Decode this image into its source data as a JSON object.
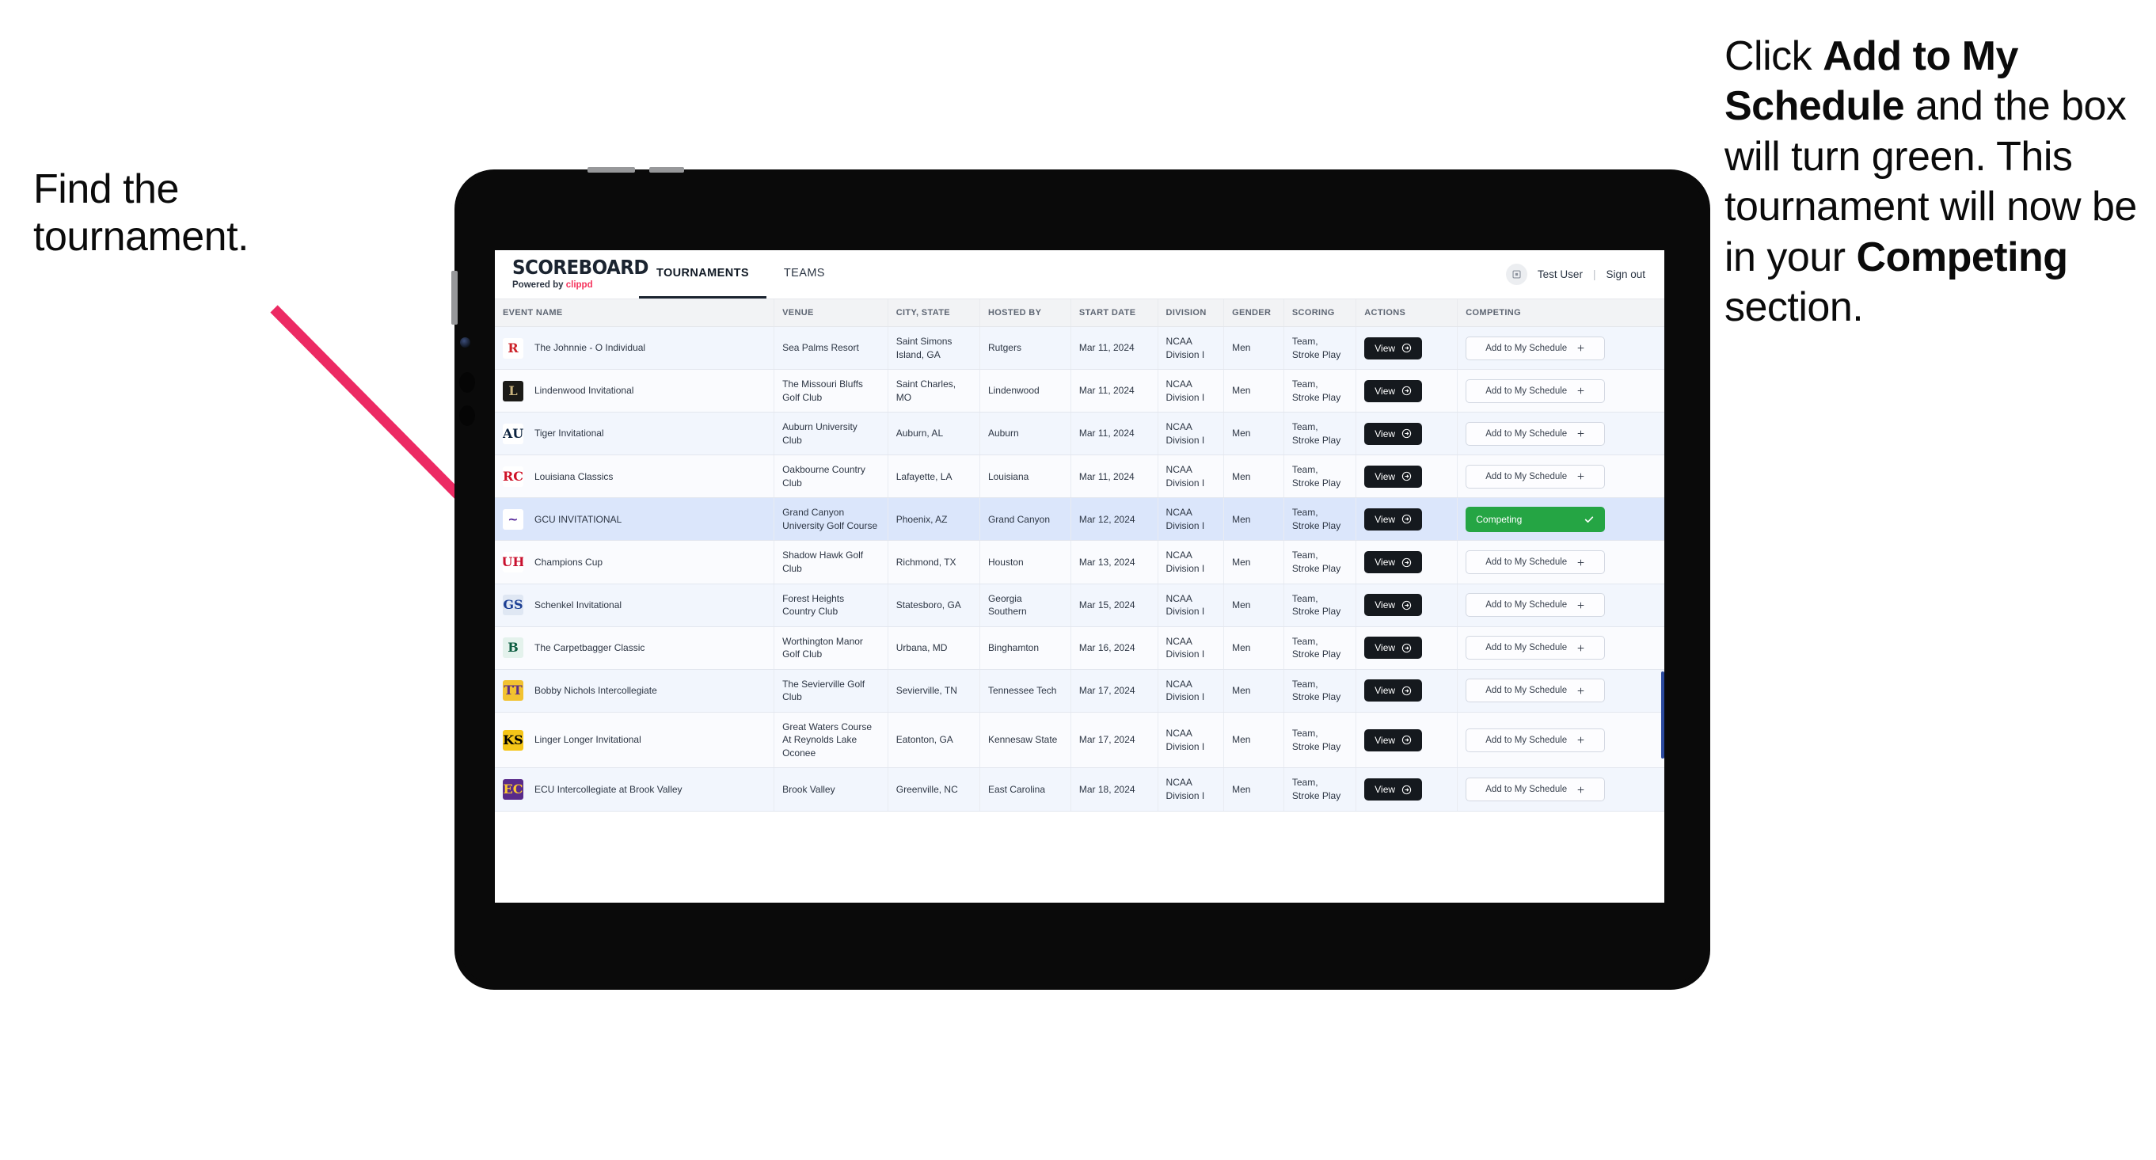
{
  "annotations": {
    "left": {
      "line1": "Find the",
      "line2": "tournament."
    },
    "right": {
      "p1_pre": "Click ",
      "p1_bold": "Add to My Schedule",
      "p1_post": " and the box will turn green. This tournament will now be in your ",
      "p2_bold": "Competing",
      "p2_post": " section."
    }
  },
  "app": {
    "brand": {
      "title": "SCOREBOARD",
      "powered_prefix": "Powered by ",
      "powered_name": "clippd"
    },
    "tabs": [
      {
        "label": "TOURNAMENTS",
        "active": true
      },
      {
        "label": "TEAMS",
        "active": false
      }
    ],
    "account": {
      "user": "Test User",
      "separator": "|",
      "signout": "Sign out",
      "avatar_icon": "user-avatar-icon"
    },
    "table": {
      "columns": [
        "EVENT NAME",
        "VENUE",
        "CITY, STATE",
        "HOSTED BY",
        "START DATE",
        "DIVISION",
        "GENDER",
        "SCORING",
        "ACTIONS",
        "COMPETING"
      ],
      "view_label": "View",
      "add_label": "Add to My Schedule",
      "add_plus": "+",
      "competing_label": "Competing",
      "rows": [
        {
          "event": "The Johnnie - O Individual",
          "venue": "Sea Palms Resort",
          "city": "Saint Simons Island, GA",
          "hosted_by": "Rutgers",
          "start_date": "Mar 11, 2024",
          "division": "NCAA Division I",
          "gender": "Men",
          "scoring": "Team, Stroke Play",
          "competing": false,
          "logo_text": "R",
          "logo_fg": "#cc2229",
          "logo_bg": "#ffffff"
        },
        {
          "event": "Lindenwood Invitational",
          "venue": "The Missouri Bluffs Golf Club",
          "city": "Saint Charles, MO",
          "hosted_by": "Lindenwood",
          "start_date": "Mar 11, 2024",
          "division": "NCAA Division I",
          "gender": "Men",
          "scoring": "Team, Stroke Play",
          "competing": false,
          "logo_text": "L",
          "logo_fg": "#c9b37e",
          "logo_bg": "#1b1a17"
        },
        {
          "event": "Tiger Invitational",
          "venue": "Auburn University Club",
          "city": "Auburn, AL",
          "hosted_by": "Auburn",
          "start_date": "Mar 11, 2024",
          "division": "NCAA Division I",
          "gender": "Men",
          "scoring": "Team, Stroke Play",
          "competing": false,
          "logo_text": "AU",
          "logo_fg": "#0c2340",
          "logo_bg": "#ffffff"
        },
        {
          "event": "Louisiana Classics",
          "venue": "Oakbourne Country Club",
          "city": "Lafayette, LA",
          "hosted_by": "Louisiana",
          "start_date": "Mar 11, 2024",
          "division": "NCAA Division I",
          "gender": "Men",
          "scoring": "Team, Stroke Play",
          "competing": false,
          "logo_text": "RC",
          "logo_fg": "#ce1126",
          "logo_bg": "#ffffff"
        },
        {
          "event": "GCU INVITATIONAL",
          "venue": "Grand Canyon University Golf Course",
          "city": "Phoenix, AZ",
          "hosted_by": "Grand Canyon",
          "start_date": "Mar 12, 2024",
          "division": "NCAA Division I",
          "gender": "Men",
          "scoring": "Team, Stroke Play",
          "competing": true,
          "logo_text": "~",
          "logo_fg": "#522398",
          "logo_bg": "#ffffff"
        },
        {
          "event": "Champions Cup",
          "venue": "Shadow Hawk Golf Club",
          "city": "Richmond, TX",
          "hosted_by": "Houston",
          "start_date": "Mar 13, 2024",
          "division": "NCAA Division I",
          "gender": "Men",
          "scoring": "Team, Stroke Play",
          "competing": false,
          "logo_text": "UH",
          "logo_fg": "#c8102e",
          "logo_bg": "#ffffff"
        },
        {
          "event": "Schenkel Invitational",
          "venue": "Forest Heights Country Club",
          "city": "Statesboro, GA",
          "hosted_by": "Georgia Southern",
          "start_date": "Mar 15, 2024",
          "division": "NCAA Division I",
          "gender": "Men",
          "scoring": "Team, Stroke Play",
          "competing": false,
          "logo_text": "GS",
          "logo_fg": "#1c3f94",
          "logo_bg": "#dfe7f3"
        },
        {
          "event": "The Carpetbagger Classic",
          "venue": "Worthington Manor Golf Club",
          "city": "Urbana, MD",
          "hosted_by": "Binghamton",
          "start_date": "Mar 16, 2024",
          "division": "NCAA Division I",
          "gender": "Men",
          "scoring": "Team, Stroke Play",
          "competing": false,
          "logo_text": "B",
          "logo_fg": "#0b5c3f",
          "logo_bg": "#e4f2ec"
        },
        {
          "event": "Bobby Nichols Intercollegiate",
          "venue": "The Sevierville Golf Club",
          "city": "Sevierville, TN",
          "hosted_by": "Tennessee Tech",
          "start_date": "Mar 17, 2024",
          "division": "NCAA Division I",
          "gender": "Men",
          "scoring": "Team, Stroke Play",
          "competing": false,
          "logo_text": "TT",
          "logo_fg": "#5b2d86",
          "logo_bg": "#f2c230"
        },
        {
          "event": "Linger Longer Invitational",
          "venue": "Great Waters Course At Reynolds Lake Oconee",
          "city": "Eatonton, GA",
          "hosted_by": "Kennesaw State",
          "start_date": "Mar 17, 2024",
          "division": "NCAA Division I",
          "gender": "Men",
          "scoring": "Team, Stroke Play",
          "competing": false,
          "logo_text": "KS",
          "logo_fg": "#000000",
          "logo_bg": "#f5c518"
        },
        {
          "event": "ECU Intercollegiate at Brook Valley",
          "venue": "Brook Valley",
          "city": "Greenville, NC",
          "hosted_by": "East Carolina",
          "start_date": "Mar 18, 2024",
          "division": "NCAA Division I",
          "gender": "Men",
          "scoring": "Team, Stroke Play",
          "competing": false,
          "logo_text": "EC",
          "logo_fg": "#fdc82f",
          "logo_bg": "#592a8a"
        }
      ]
    }
  },
  "colors": {
    "accent_pink": "#ec2a63",
    "competing_green": "#25a544",
    "dark_button": "#15191e",
    "row_highlight": "#dbe6fb",
    "brand_red": "#f5325b"
  }
}
